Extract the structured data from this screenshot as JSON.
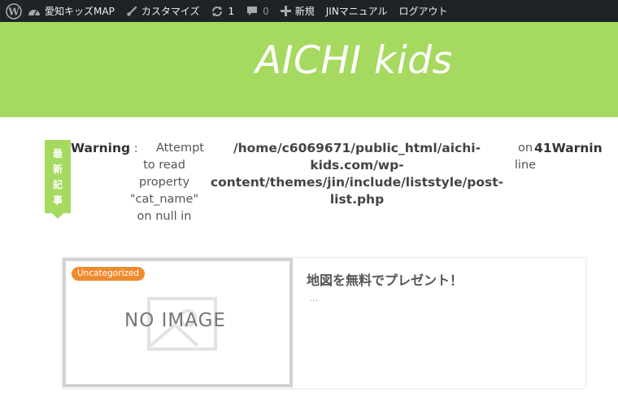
{
  "adminbar": {
    "site_name": "愛知キッズMAP",
    "customize": "カスタマイズ",
    "updates_count": "1",
    "comments_count": "0",
    "new": "新規",
    "jin_manual": "JINマニュアル",
    "logout": "ログアウト"
  },
  "header": {
    "title": "AICHI kids"
  },
  "ribbon": {
    "chars": [
      "最",
      "新",
      "記",
      "事"
    ]
  },
  "warning": {
    "label": "Warning",
    "sep": ":",
    "message_lines": [
      "Attempt",
      "to read",
      "property",
      "\"cat_name\"",
      "on null in"
    ],
    "path_lines": [
      "/home/c6069671/public_html/aichi-",
      "kids.com/wp-",
      "content/themes/jin/include/liststyle/post-",
      "list.php"
    ],
    "on": "on",
    "line_word": "line",
    "line_number": "41",
    "trailing": "Warnin"
  },
  "post": {
    "category": "Uncategorized",
    "noimage": "NO IMAGE",
    "title": "地図を無料でプレゼント！",
    "excerpt": "…"
  },
  "colors": {
    "header": "#a6d95f",
    "badge": "#f08a2e",
    "adminbar": "#1d2327"
  }
}
